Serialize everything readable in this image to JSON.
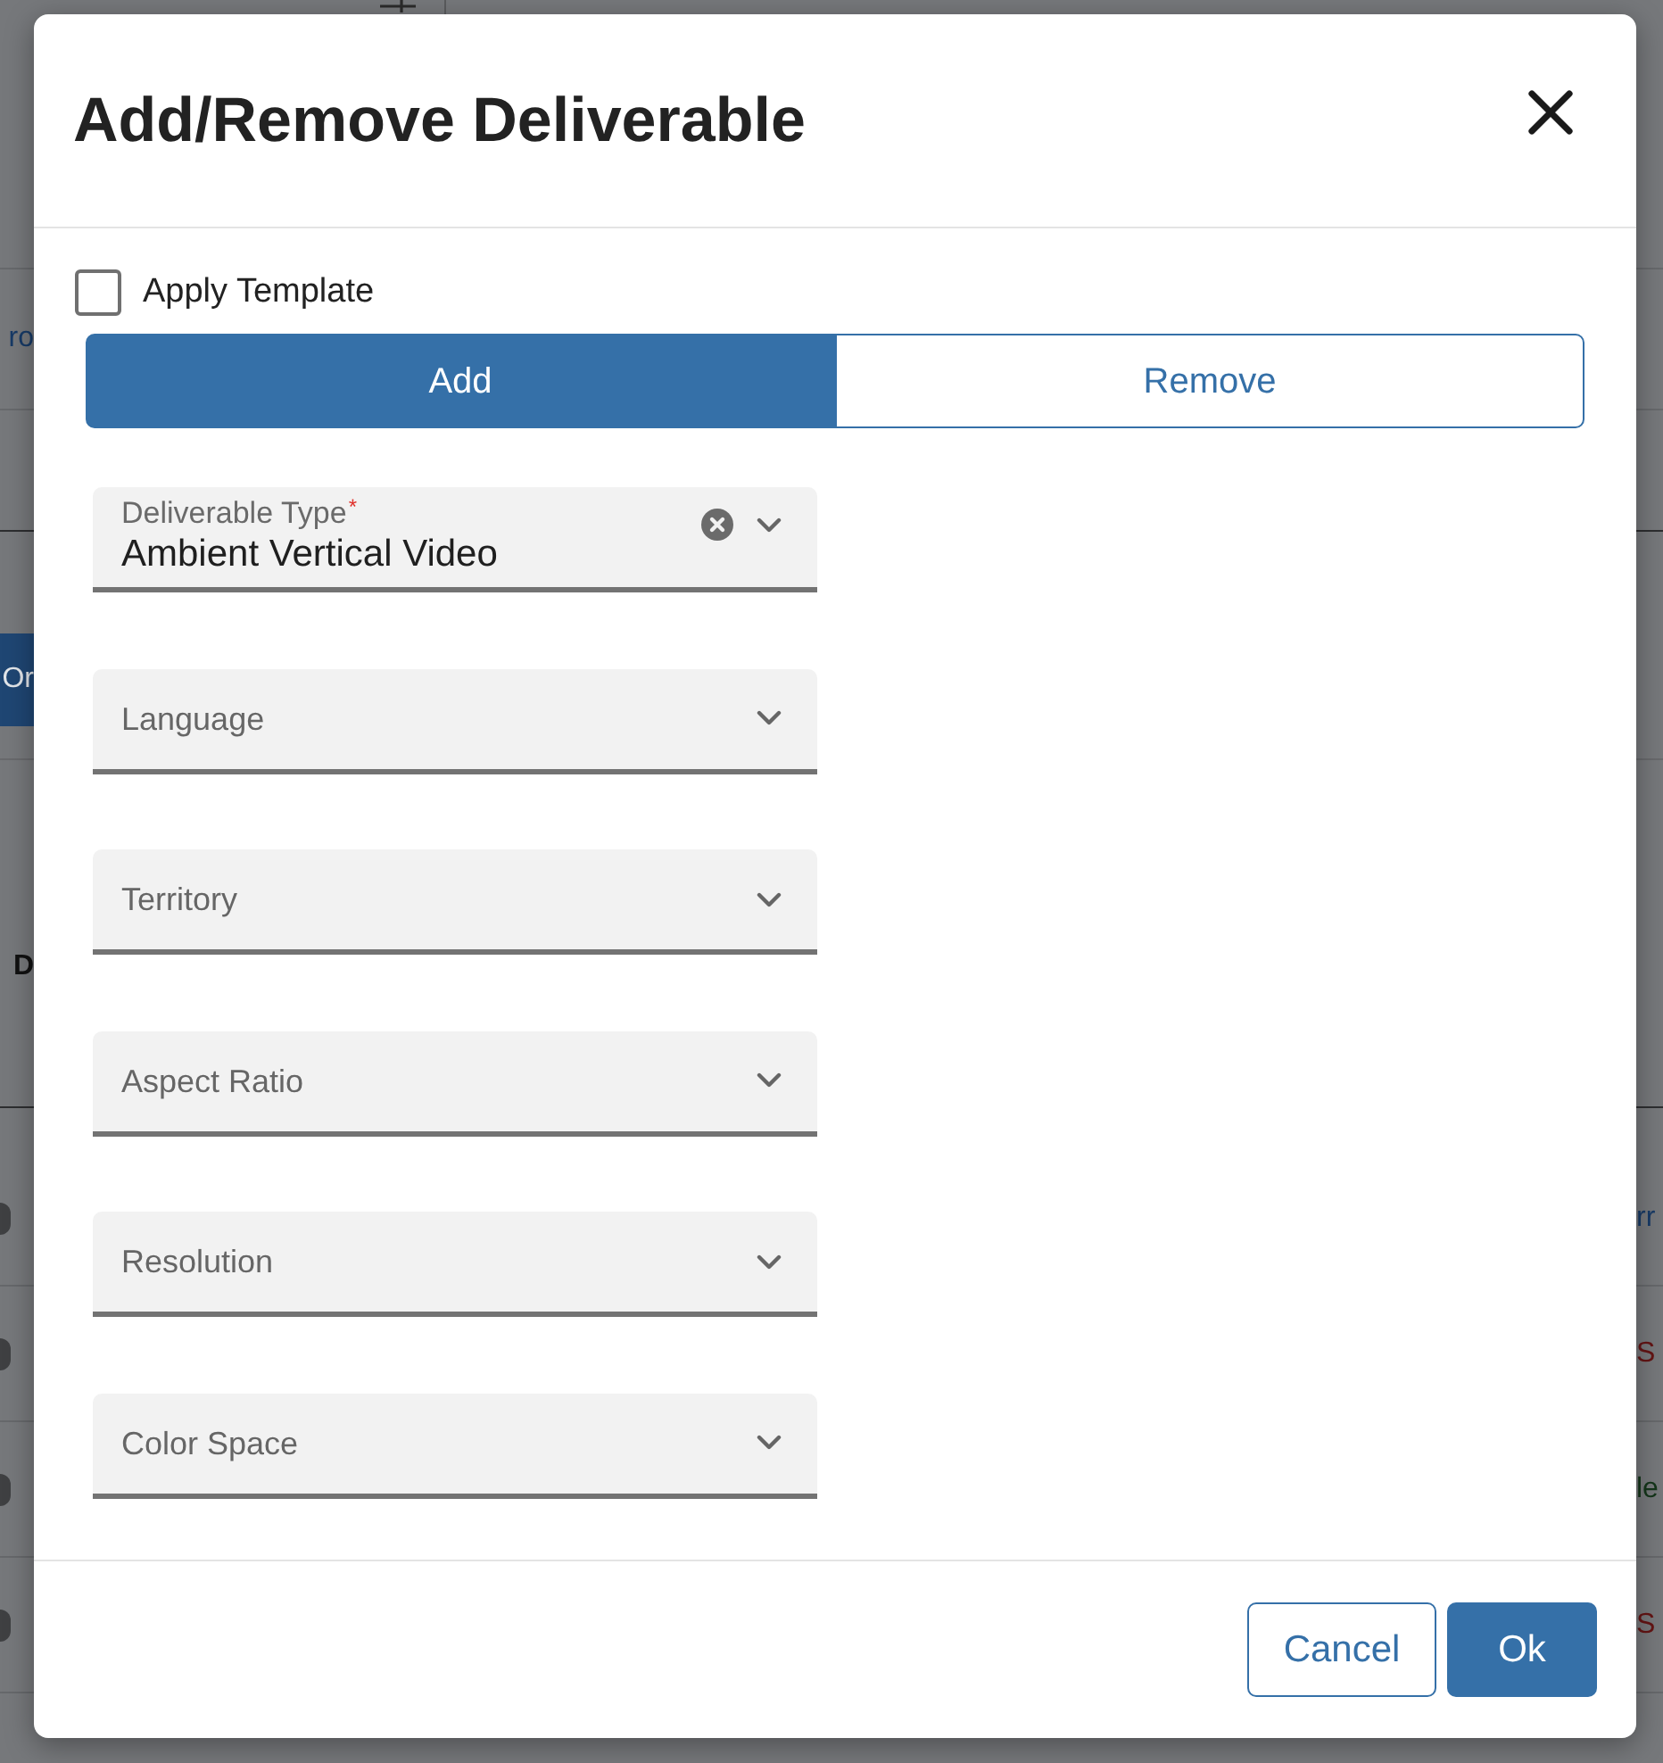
{
  "backdrop": {
    "left_fragments": [
      {
        "kind": "link",
        "text": "ro"
      },
      {
        "kind": "button",
        "text": "Or"
      },
      {
        "kind": "heading",
        "text": "D"
      }
    ],
    "table_rows": [
      {
        "status": {
          "kind": "link",
          "text": "rr"
        }
      },
      {
        "status": {
          "kind": "error",
          "text": "S"
        }
      },
      {
        "status": {
          "kind": "success",
          "text": "le"
        }
      },
      {
        "status": {
          "kind": "error",
          "text": "S"
        }
      }
    ]
  },
  "dialog": {
    "title": "Add/Remove Deliverable",
    "apply_template": {
      "label": "Apply Template",
      "checked": false
    },
    "mode_tabs": [
      {
        "label": "Add",
        "selected": true
      },
      {
        "label": "Remove",
        "selected": false
      }
    ],
    "fields": [
      {
        "label": "Deliverable Type",
        "required_mark": "*",
        "value": "Ambient Vertical Video"
      },
      {
        "label": "Language"
      },
      {
        "label": "Territory"
      },
      {
        "label": "Aspect Ratio"
      },
      {
        "label": "Resolution"
      },
      {
        "label": "Color Space"
      }
    ],
    "buttons": [
      {
        "kind": "secondary",
        "label": "Cancel"
      },
      {
        "kind": "primary",
        "label": "Ok"
      }
    ]
  }
}
